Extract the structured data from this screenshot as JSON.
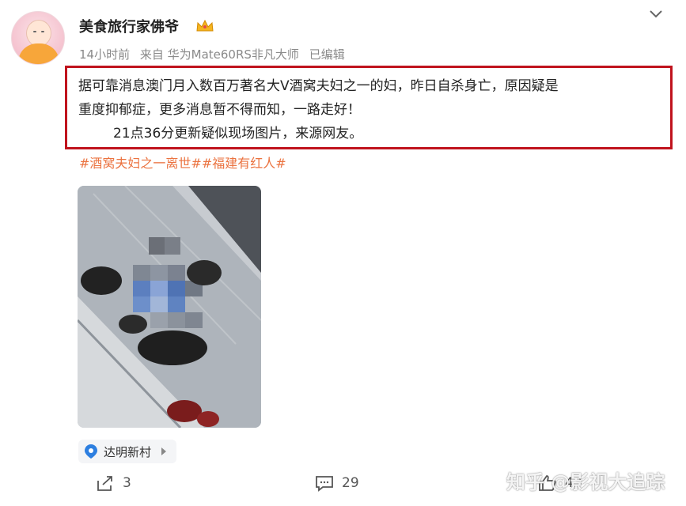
{
  "user": {
    "name": "美食旅行家佛爷",
    "time": "14小时前",
    "source": "来自 华为Mate60RS非凡大师",
    "edited": "已编辑"
  },
  "post": {
    "line1": "据可靠消息澳门月入数百万著名大V酒窝夫妇之一的妇，昨日自杀身亡，原因疑是",
    "line2": "重度抑郁症，更多消息暂不得而知，一路走好！",
    "line3": "21点36分更新疑似现场图片，来源网友。",
    "tags": "#酒窝夫妇之一离世##福建有红人#"
  },
  "location": {
    "label": "达明新村"
  },
  "actions": {
    "share_count": "3",
    "comment_count": "29",
    "like_count": "43"
  },
  "watermark": "知乎 @影视大追踪",
  "colors": {
    "highlight_border": "#c0131d",
    "tag_color": "#eb7340",
    "location_pin": "#2d7fe0"
  }
}
